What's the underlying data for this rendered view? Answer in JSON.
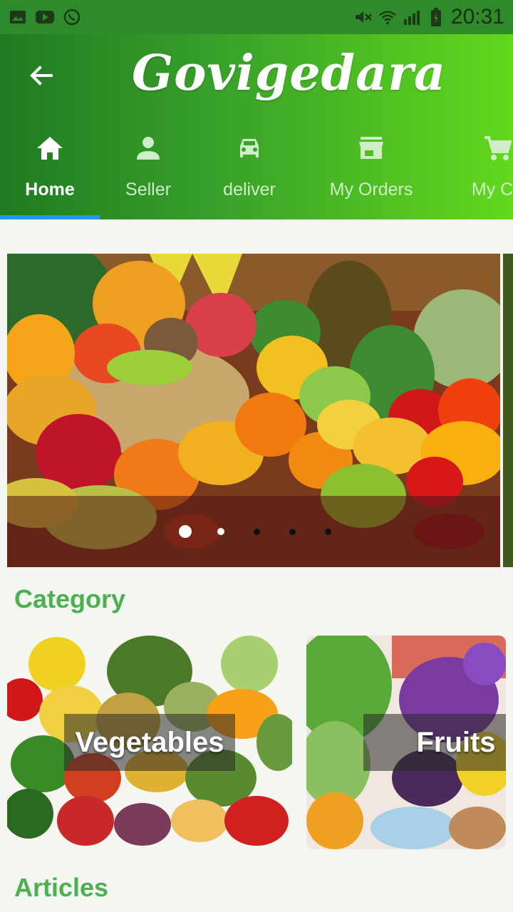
{
  "app": {
    "title": "Govigedara"
  },
  "status_bar": {
    "time": "20:31",
    "left_icons": [
      "image-icon",
      "youtube-icon",
      "whatsapp-icon"
    ],
    "right_icons": [
      "mute-icon",
      "wifi-icon",
      "signal-icon",
      "battery-icon"
    ]
  },
  "tabs": [
    {
      "label": "Home",
      "icon": "home-icon",
      "active": true
    },
    {
      "label": "Seller",
      "icon": "person-icon",
      "active": false
    },
    {
      "label": "deliver",
      "icon": "car-icon",
      "active": false
    },
    {
      "label": "My Orders",
      "icon": "store-icon",
      "active": false
    },
    {
      "label": "My Ca",
      "icon": "cart-icon",
      "active": false
    }
  ],
  "banner": {
    "slide_count": 5,
    "active_index": 0
  },
  "category": {
    "title": "Category",
    "items": [
      {
        "label": "Vegetables"
      },
      {
        "label": "Fruits"
      }
    ]
  },
  "articles": {
    "title": "Articles"
  },
  "colors": {
    "accent": "#4caf50",
    "tab_indicator": "#2196f3",
    "appbar_start": "#1f7a22",
    "appbar_end": "#62d81c"
  }
}
